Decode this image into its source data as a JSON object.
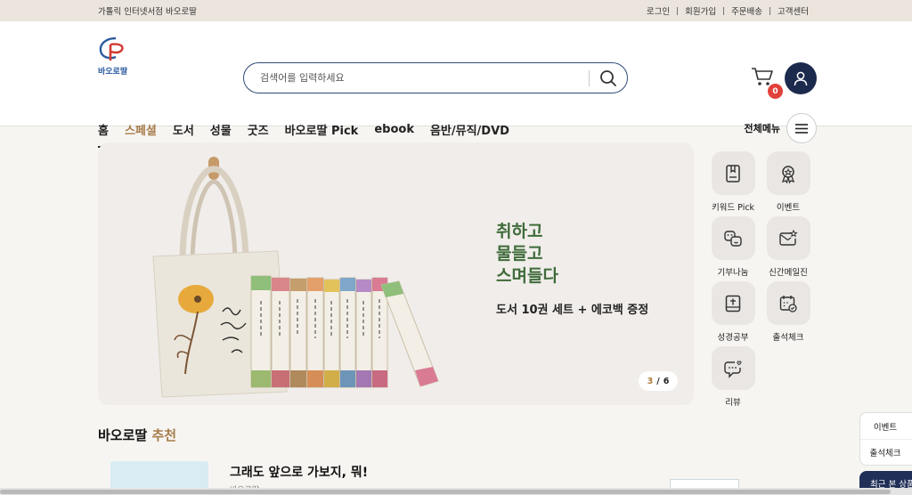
{
  "topbar": {
    "brand_text": "가톨릭 인터넷서점 바오로딸",
    "links": [
      "로그인",
      "회원가입",
      "주문배송",
      "고객센터"
    ]
  },
  "header": {
    "logo_text": "바오로딸",
    "search_placeholder": "검색어를 입력하세요",
    "cart_count": "0"
  },
  "nav": {
    "items": [
      "홈",
      "스페셜",
      "도서",
      "성물",
      "굿즈",
      "바오로딸 Pick",
      "ebook",
      "음반/뮤직/DVD"
    ],
    "active": "홈",
    "all_menu_label": "전체메뉴"
  },
  "banner": {
    "headline": [
      "취하고",
      "물들고",
      "스며들다"
    ],
    "subline": "도서 10권 세트 + 에코백 증정",
    "pager_current": "3",
    "pager_sep": "/",
    "pager_total": "6"
  },
  "quick_menu": [
    {
      "label": "키워드 Pick",
      "icon": "bookmark-book-icon"
    },
    {
      "label": "이벤트",
      "icon": "award-badge-icon"
    },
    {
      "label": "기부나눔",
      "icon": "share-faces-icon"
    },
    {
      "label": "신간메일진",
      "icon": "mail-star-icon"
    },
    {
      "label": "성경공부",
      "icon": "cross-book-icon"
    },
    {
      "label": "출석체크",
      "icon": "calendar-check-icon"
    },
    {
      "label": "리뷰",
      "icon": "chat-heart-icon"
    }
  ],
  "recommend": {
    "title_prefix": "바오로딸 ",
    "title_highlight": "추천",
    "book_title": "그래도 앞으로 가보지, 뭐!",
    "book_meta": "바오로딸"
  },
  "side": {
    "items": [
      "이벤트",
      "출석체크"
    ],
    "recent_label": "최근 본 상품"
  },
  "colors": {
    "accent_brown": "#a67c4a",
    "navy": "#1c2a4e",
    "green_headline": "#3f6b3a",
    "badge_red": "#e0413a"
  }
}
